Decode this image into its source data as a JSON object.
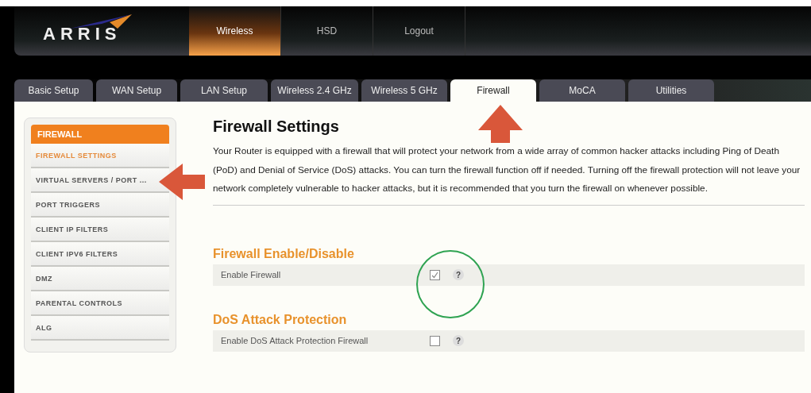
{
  "header": {
    "logo": "ARRIS",
    "nav": [
      {
        "label": "Wireless",
        "selected": true
      },
      {
        "label": "HSD",
        "selected": false
      },
      {
        "label": "Logout",
        "selected": false
      }
    ]
  },
  "tabs": [
    {
      "label": "Basic Setup",
      "selected": false
    },
    {
      "label": "WAN Setup",
      "selected": false
    },
    {
      "label": "LAN Setup",
      "selected": false
    },
    {
      "label": "Wireless 2.4 GHz",
      "selected": false
    },
    {
      "label": "Wireless 5 GHz",
      "selected": false
    },
    {
      "label": "Firewall",
      "selected": true
    },
    {
      "label": "MoCA",
      "selected": false
    },
    {
      "label": "Utilities",
      "selected": false
    }
  ],
  "sidebar": {
    "title": "FIREWALL",
    "items": [
      {
        "label": "FIREWALL SETTINGS",
        "selected": true
      },
      {
        "label": "VIRTUAL SERVERS / PORT ...",
        "selected": false
      },
      {
        "label": "PORT TRIGGERS",
        "selected": false
      },
      {
        "label": "CLIENT IP FILTERS",
        "selected": false
      },
      {
        "label": "CLIENT IPV6 FILTERS",
        "selected": false
      },
      {
        "label": "DMZ",
        "selected": false
      },
      {
        "label": "PARENTAL CONTROLS",
        "selected": false
      },
      {
        "label": "ALG",
        "selected": false
      }
    ]
  },
  "main": {
    "title": "Firewall Settings",
    "description": "Your Router is equipped with a firewall that will protect your network from a wide array of common hacker attacks including Ping of Death (PoD) and Denial of Service (DoS) attacks. You can turn the firewall function off if needed. Turning off the firewall protection will not leave your network completely vulnerable to hacker attacks, but it is recommended that you turn the firewall on whenever possible.",
    "sections": [
      {
        "title": "Firewall Enable/Disable",
        "option": {
          "label": "Enable Firewall",
          "checked": true,
          "help": "?"
        }
      },
      {
        "title": "DoS Attack Protection",
        "option": {
          "label": "Enable DoS Attack Protection Firewall",
          "checked": false,
          "help": "?"
        }
      }
    ]
  }
}
